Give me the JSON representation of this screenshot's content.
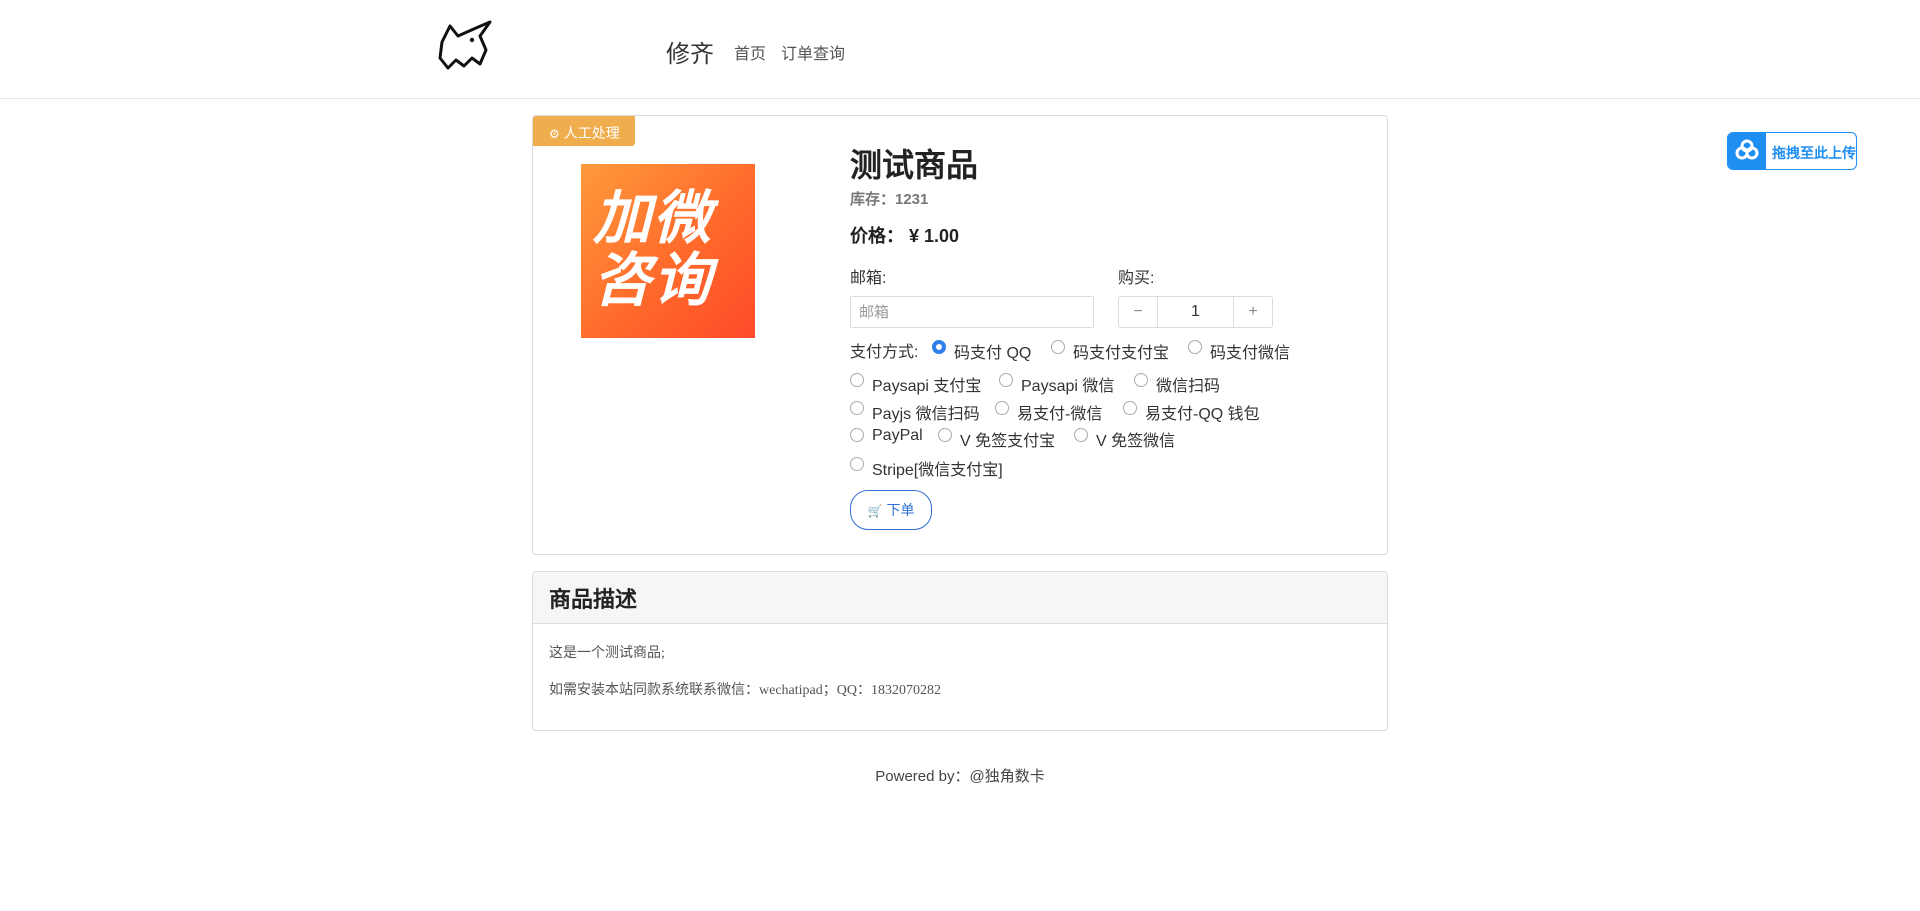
{
  "header": {
    "brand": "修齐",
    "nav": {
      "home": "首页",
      "order_query": "订单查询"
    }
  },
  "upload_widget": {
    "label": "拖拽至此上传",
    "icon": "cloud-upload-icon",
    "color": "#1f8ef1"
  },
  "product": {
    "badge": "人工处理",
    "image_text": [
      "加微",
      "咨询"
    ],
    "title": "测试商品",
    "stock": "库存：1231",
    "price": "价格： ¥ 1.00",
    "email_label": "邮箱:",
    "email_placeholder": "邮箱",
    "buy_label": "购买:",
    "quantity": "1",
    "minus": "−",
    "plus": "+",
    "payment_label": "支付方式:",
    "payment_options": [
      {
        "label": "码支付 QQ",
        "checked": true
      },
      {
        "label": "码支付支付宝",
        "checked": false
      },
      {
        "label": "码支付微信",
        "checked": false
      },
      {
        "label": "Paysapi 支付宝",
        "checked": false
      },
      {
        "label": "Paysapi 微信",
        "checked": false
      },
      {
        "label": "微信扫码",
        "checked": false
      },
      {
        "label": "Payjs 微信扫码",
        "checked": false
      },
      {
        "label": "易支付-微信",
        "checked": false
      },
      {
        "label": "易支付-QQ 钱包",
        "checked": false
      },
      {
        "label": "PayPal",
        "checked": false
      },
      {
        "label": "V 免签支付宝",
        "checked": false
      },
      {
        "label": "V 免签微信",
        "checked": false
      },
      {
        "label": "Stripe[微信支付宝]",
        "checked": false
      }
    ],
    "order_button": "下单",
    "accent_color": "#2f80ed",
    "badge_color": "#f0ad4e"
  },
  "description": {
    "title": "商品描述",
    "lines": [
      "这是一个测试商品;",
      "如需安装本站同款系统联系微信：wechatipad；QQ：1832070282"
    ]
  },
  "footer": {
    "text": "Powered by：@独角数卡"
  }
}
